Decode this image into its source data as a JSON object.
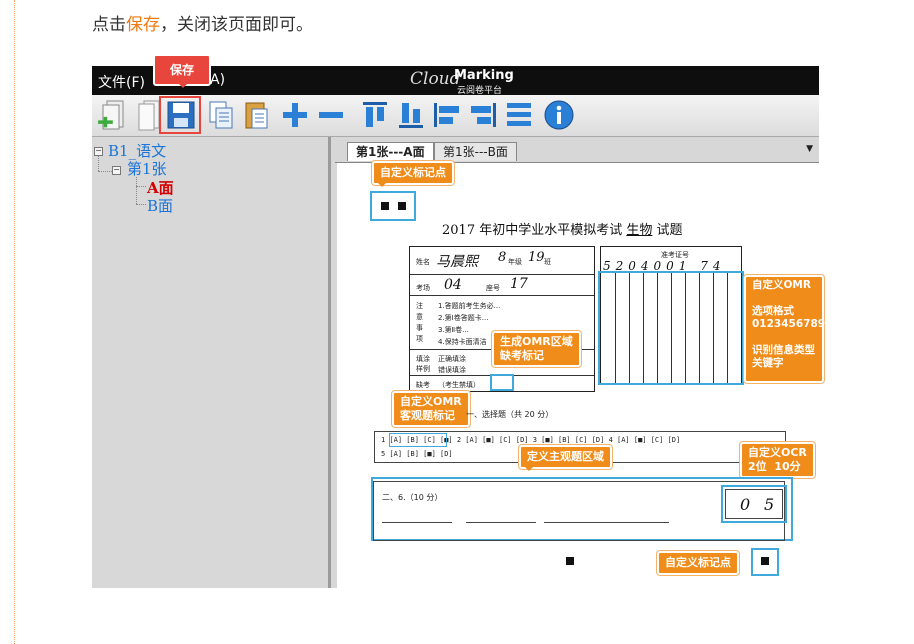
{
  "intro": {
    "before": "点击",
    "highlight": "保存",
    "after": "，关闭该页面即可。"
  },
  "app": {
    "menu": {
      "file": "文件(F)",
      "partial": "A)"
    },
    "logo": {
      "cloud": "Cloud",
      "marking": "Marking",
      "sub": "云阅卷平台"
    },
    "save_callout": "保存",
    "toolbar_icons": [
      "import-icon",
      "blank-doc-icon",
      "save-icon",
      "copy-icon",
      "paste-icon",
      "add-icon",
      "remove-icon",
      "align-top-icon",
      "align-bottom-icon",
      "align-left-icon",
      "align-right-icon",
      "distribute-icon",
      "info-icon"
    ]
  },
  "tree": {
    "root": "B1_语文",
    "sheet": "第1张",
    "side_a": "A面",
    "side_b": "B面"
  },
  "tabs": {
    "a": "第1张---A面",
    "b": "第1张---B面",
    "dropdown": "▼"
  },
  "doc": {
    "exam_title_pre": "2017 年初中学业水平模拟考试",
    "exam_subject": "生物",
    "exam_title_post": "试题",
    "name_label": "姓名",
    "name_value": "马晨熙",
    "grade_label": "年级",
    "grade_value": "8",
    "class_label": "班",
    "class_value": "19",
    "room_label": "考场",
    "room_value": "04",
    "seat_label": "座号",
    "seat_value": "17",
    "notes_title": "注意事项",
    "note1": "1.答题前考生务必...",
    "note2": "2.第Ⅰ卷答题卡...",
    "note3": "3.第Ⅱ卷...",
    "note4": "4.保持卡面清洁",
    "fill_label": "填涂样例",
    "fill_correct": "正确填涂",
    "fill_wrong": "错误填涂",
    "absent_label": "缺考",
    "absent_note": "（考生禁填）",
    "id_label": "准考证号",
    "id_digits": "5204001 74",
    "section1": "一、选择题（共 20 分）",
    "section2": "二、6.（10 分）",
    "score_digits": [
      "0",
      "5"
    ]
  },
  "callouts": {
    "mark_top": "自定义标记点",
    "omr_missing": "生成OMR区域\n缺考标记",
    "omr_custom": "自定义OMR\n\n选项格式\n0123456789\n\n识别信息类型\n关键字",
    "omr_objective": "自定义OMR\n客观题标记",
    "subjective": "定义主观题区域",
    "ocr": "自定义OCR\n2位  10分",
    "mark_bottom": "自定义标记点"
  },
  "answers_row1": "1 [A] [B] [C] [■]    2 [A] [■] [C] [D]    3 [■] [B] [C] [D]    4 [A] [■] [C] [D]",
  "answers_row2": "5 [A] [B] [■] [D]"
}
